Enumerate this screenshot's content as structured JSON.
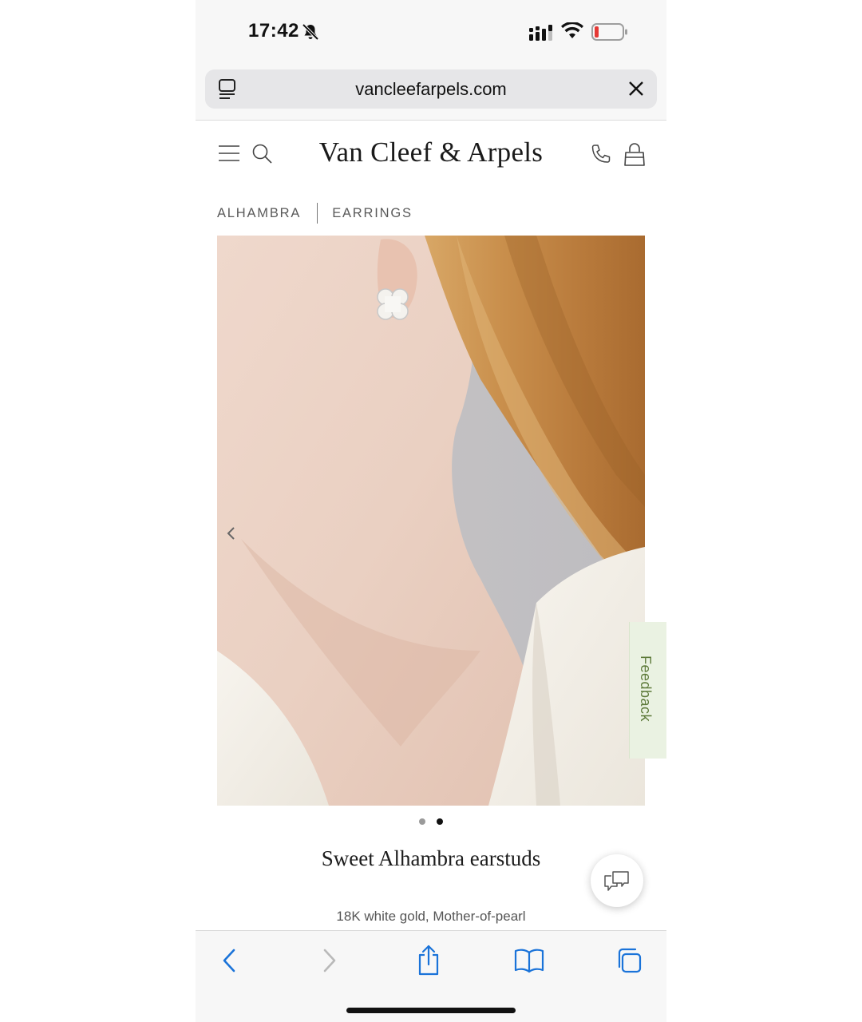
{
  "status_bar": {
    "time": "17:42",
    "icons": [
      "bell-slash-icon",
      "cellular-signal-icon",
      "wifi-icon",
      "battery-low-icon"
    ],
    "battery_color": "#e53935"
  },
  "browser": {
    "url": "vancleefarpels.com",
    "icons": [
      "reader-mode-icon",
      "close-icon"
    ]
  },
  "site_header": {
    "logo_text": "Van Cleef & Arpels",
    "icons": [
      "menu-icon",
      "search-icon",
      "phone-icon",
      "shopping-bag-icon"
    ]
  },
  "breadcrumb": {
    "items": [
      "ALHAMBRA",
      "EARRINGS"
    ]
  },
  "carousel": {
    "prev_icon": "chevron-left-icon",
    "dot_count": 2,
    "active_dot": 2
  },
  "product": {
    "title": "Sweet Alhambra earstuds",
    "material": "18K white gold, Mother-of-pearl"
  },
  "feedback": {
    "label": "Feedback",
    "accent": "#5d7a3a"
  },
  "chat": {
    "icon": "chat-bubbles-icon"
  },
  "toolbar": {
    "icons": [
      "back-icon",
      "forward-icon",
      "share-icon",
      "bookmarks-icon",
      "tabs-icon"
    ],
    "accent": "#1a73d9"
  }
}
